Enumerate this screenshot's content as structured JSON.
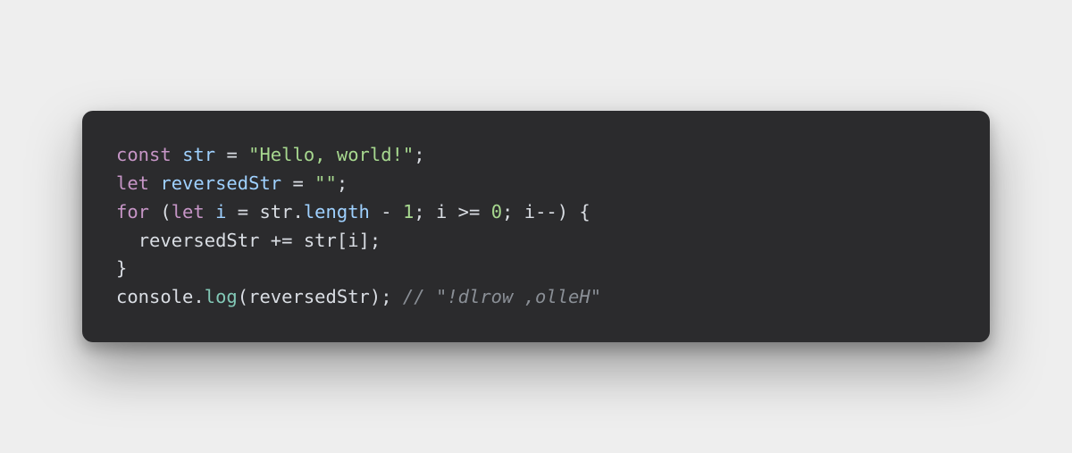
{
  "code": {
    "language": "javascript",
    "lines": [
      [
        {
          "cls": "tok-kw",
          "t": "const"
        },
        {
          "cls": "tok-punc",
          "t": " "
        },
        {
          "cls": "tok-id",
          "t": "str"
        },
        {
          "cls": "tok-punc",
          "t": " "
        },
        {
          "cls": "tok-op",
          "t": "="
        },
        {
          "cls": "tok-punc",
          "t": " "
        },
        {
          "cls": "tok-str",
          "t": "\"Hello, world!\""
        },
        {
          "cls": "tok-punc",
          "t": ";"
        }
      ],
      [
        {
          "cls": "tok-kw",
          "t": "let"
        },
        {
          "cls": "tok-punc",
          "t": " "
        },
        {
          "cls": "tok-id",
          "t": "reversedStr"
        },
        {
          "cls": "tok-punc",
          "t": " "
        },
        {
          "cls": "tok-op",
          "t": "="
        },
        {
          "cls": "tok-punc",
          "t": " "
        },
        {
          "cls": "tok-str",
          "t": "\"\""
        },
        {
          "cls": "tok-punc",
          "t": ";"
        }
      ],
      [
        {
          "cls": "tok-kw",
          "t": "for"
        },
        {
          "cls": "tok-punc",
          "t": " ("
        },
        {
          "cls": "tok-kw",
          "t": "let"
        },
        {
          "cls": "tok-punc",
          "t": " "
        },
        {
          "cls": "tok-id",
          "t": "i"
        },
        {
          "cls": "tok-punc",
          "t": " "
        },
        {
          "cls": "tok-op",
          "t": "="
        },
        {
          "cls": "tok-punc",
          "t": " "
        },
        {
          "cls": "tok-use",
          "t": "str"
        },
        {
          "cls": "tok-punc",
          "t": "."
        },
        {
          "cls": "tok-prop",
          "t": "length"
        },
        {
          "cls": "tok-punc",
          "t": " "
        },
        {
          "cls": "tok-op",
          "t": "-"
        },
        {
          "cls": "tok-punc",
          "t": " "
        },
        {
          "cls": "tok-num",
          "t": "1"
        },
        {
          "cls": "tok-punc",
          "t": "; "
        },
        {
          "cls": "tok-use",
          "t": "i"
        },
        {
          "cls": "tok-punc",
          "t": " "
        },
        {
          "cls": "tok-op",
          "t": ">="
        },
        {
          "cls": "tok-punc",
          "t": " "
        },
        {
          "cls": "tok-num",
          "t": "0"
        },
        {
          "cls": "tok-punc",
          "t": "; "
        },
        {
          "cls": "tok-use",
          "t": "i"
        },
        {
          "cls": "tok-op",
          "t": "--"
        },
        {
          "cls": "tok-punc",
          "t": ") {"
        }
      ],
      [
        {
          "cls": "tok-punc",
          "t": "  "
        },
        {
          "cls": "tok-use",
          "t": "reversedStr"
        },
        {
          "cls": "tok-punc",
          "t": " "
        },
        {
          "cls": "tok-op",
          "t": "+="
        },
        {
          "cls": "tok-punc",
          "t": " "
        },
        {
          "cls": "tok-use",
          "t": "str"
        },
        {
          "cls": "tok-punc",
          "t": "["
        },
        {
          "cls": "tok-use",
          "t": "i"
        },
        {
          "cls": "tok-punc",
          "t": "];"
        }
      ],
      [
        {
          "cls": "tok-punc",
          "t": "}"
        }
      ],
      [
        {
          "cls": "tok-use",
          "t": "console"
        },
        {
          "cls": "tok-punc",
          "t": "."
        },
        {
          "cls": "tok-call",
          "t": "log"
        },
        {
          "cls": "tok-punc",
          "t": "("
        },
        {
          "cls": "tok-use",
          "t": "reversedStr"
        },
        {
          "cls": "tok-punc",
          "t": "); "
        },
        {
          "cls": "tok-com",
          "t": "// \"!dlrow ,olleH\""
        }
      ]
    ]
  }
}
